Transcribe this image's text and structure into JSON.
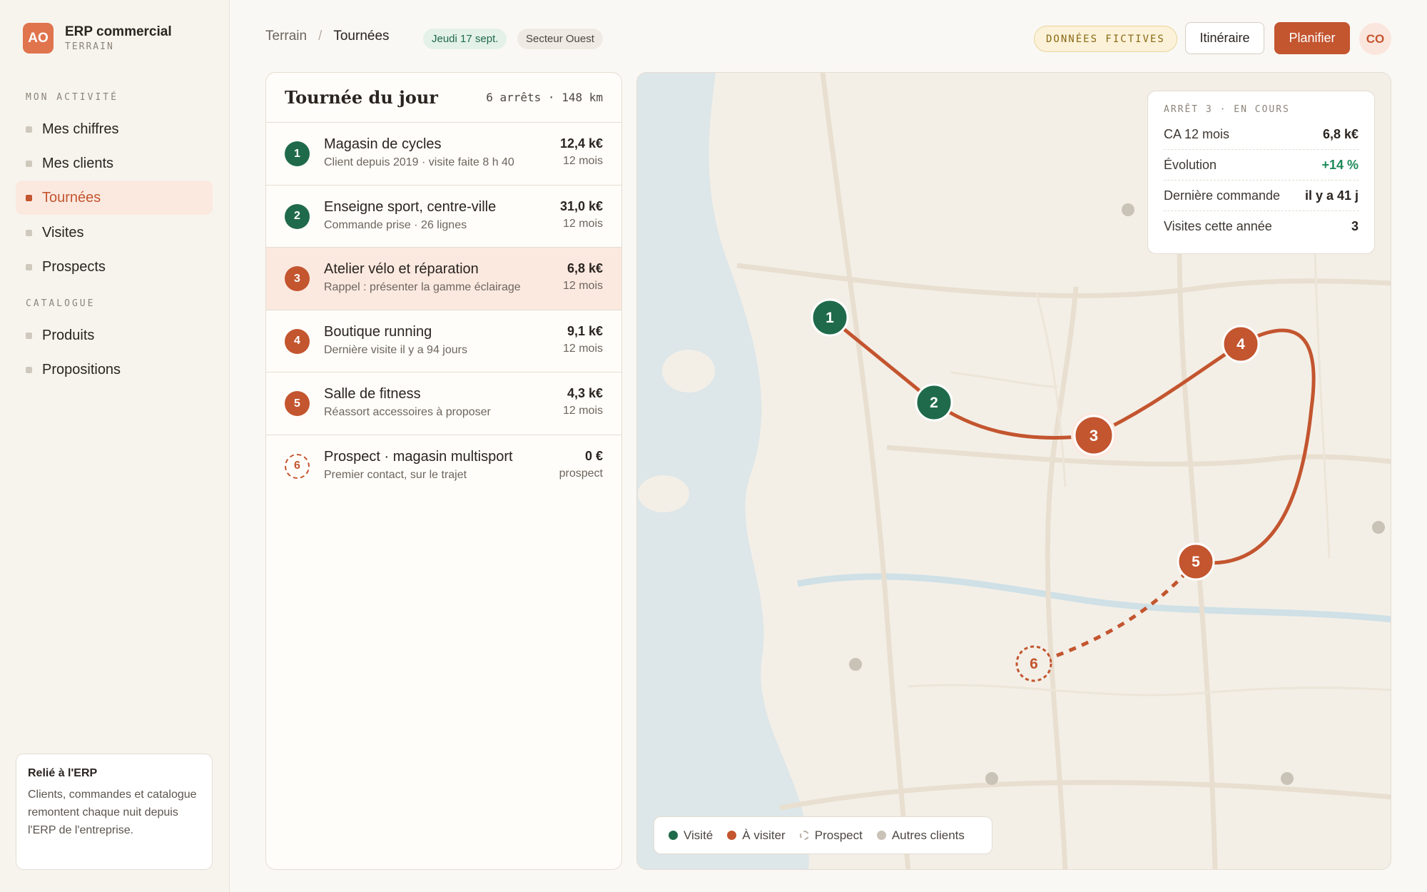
{
  "brand": {
    "initials": "AO",
    "title": "ERP commercial",
    "subtitle": "TERRAIN"
  },
  "sidebar": {
    "section_activity": "MON ACTIVITÉ",
    "activity_items": [
      {
        "label": "Mes chiffres",
        "active": false
      },
      {
        "label": "Mes clients",
        "active": false
      },
      {
        "label": "Tournées",
        "active": true
      },
      {
        "label": "Visites",
        "active": false
      },
      {
        "label": "Prospects",
        "active": false
      }
    ],
    "section_catalog": "CATALOGUE",
    "catalog_items": [
      {
        "label": "Produits"
      },
      {
        "label": "Propositions"
      }
    ],
    "erp_card": {
      "title": "Relié à l'ERP",
      "description": "Clients, commandes et catalogue remontent chaque nuit depuis l'ERP de l'entreprise."
    }
  },
  "header": {
    "breadcrumb_parent": "Terrain",
    "breadcrumb_current": "Tournées",
    "date_pill": "Jeudi 17 sept.",
    "sector_pill": "Secteur Ouest",
    "fictive_tag": "DONNÉES FICTIVES",
    "itinerary_button": "Itinéraire",
    "plan_button": "Planifier",
    "user_initials": "CO"
  },
  "tour": {
    "title": "Tournée du jour",
    "meta": "6 arrêts · 148 km",
    "stops": [
      {
        "num": "1",
        "status": "visited",
        "name": "Magasin de cycles",
        "sub": "Client depuis 2019 · visite faite 8 h 40",
        "amount": "12,4 k€",
        "period": "12 mois"
      },
      {
        "num": "2",
        "status": "visited",
        "name": "Enseigne sport, centre-ville",
        "sub": "Commande prise · 26 lignes",
        "amount": "31,0 k€",
        "period": "12 mois"
      },
      {
        "num": "3",
        "status": "todo",
        "name": "Atelier vélo et réparation",
        "sub": "Rappel : présenter la gamme éclairage",
        "amount": "6,8 k€",
        "period": "12 mois"
      },
      {
        "num": "4",
        "status": "todo",
        "name": "Boutique running",
        "sub": "Dernière visite il y a 94 jours",
        "amount": "9,1 k€",
        "period": "12 mois"
      },
      {
        "num": "5",
        "status": "todo",
        "name": "Salle de fitness",
        "sub": "Réassort accessoires à proposer",
        "amount": "4,3 k€",
        "period": "12 mois"
      },
      {
        "num": "6",
        "status": "prospect",
        "name": "Prospect · magasin multisport",
        "sub": "Premier contact, sur le trajet",
        "amount": "0 €",
        "period": "prospect"
      }
    ]
  },
  "map": {
    "info_card": {
      "header": "ARRÊT 3 · EN COURS",
      "rows": [
        {
          "key": "CA 12 mois",
          "value": "6,8 k€"
        },
        {
          "key": "Évolution",
          "value": "+14 %"
        },
        {
          "key": "Dernière commande",
          "value": "il y a 41 j"
        },
        {
          "key": "Visites cette année",
          "value": "3"
        }
      ]
    },
    "legend": {
      "visited": "Visité",
      "todo": "À visiter",
      "prospect": "Prospect",
      "other": "Autres clients"
    },
    "markers": [
      "1",
      "2",
      "3",
      "4",
      "5",
      "6"
    ]
  },
  "colors": {
    "accent": "#c3552f",
    "visited": "#1f6a4a",
    "other_clients": "#c9c2b6",
    "positive": "#1f8a5a"
  }
}
